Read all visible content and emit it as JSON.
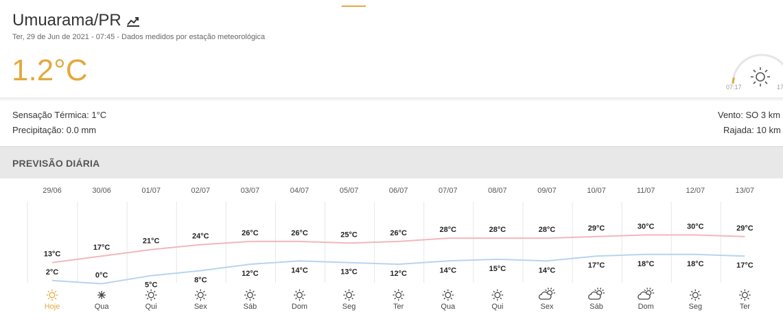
{
  "header": {
    "city": "Umuarama/PR",
    "subtitle": "Ter, 29 de Jun de 2021 - 07:45 - Dados medidos por estação meteorológica",
    "temperature": "1.2°C",
    "sunrise": "07:17",
    "sunset_partial": "17"
  },
  "details": {
    "feels_like": "Sensação Térmica: 1°C",
    "precipitation": "Precipitação: 0.0 mm",
    "wind": "Vento: SO 3 km",
    "gust": "Rajada: 10 km"
  },
  "section": {
    "title": "PREVISÃO DIÁRIA"
  },
  "colors": {
    "accent": "#e3a93c",
    "max_line": "#f2b6bc",
    "min_line": "#b6d4ef"
  },
  "chart_data": {
    "type": "line",
    "categories": [
      "29/06",
      "30/06",
      "01/07",
      "02/07",
      "03/07",
      "04/07",
      "05/07",
      "06/07",
      "07/07",
      "08/07",
      "09/07",
      "10/07",
      "11/07",
      "12/07",
      "13/07"
    ],
    "series": [
      {
        "values": [
          13,
          17,
          21,
          24,
          26,
          26,
          25,
          26,
          28,
          28,
          28,
          29,
          30,
          30,
          29
        ],
        "color": "#f2b6bc"
      },
      {
        "values": [
          2,
          0,
          5,
          8,
          12,
          14,
          13,
          12,
          14,
          15,
          14,
          17,
          18,
          18,
          17
        ],
        "color": "#b6d4ef"
      }
    ],
    "unit": "°C",
    "days": [
      "Hoje",
      "Qua",
      "Qui",
      "Sex",
      "Sáb",
      "Dom",
      "Seg",
      "Ter",
      "Qua",
      "Qui",
      "Sex",
      "Sáb",
      "Dom",
      "Seg",
      "Ter"
    ],
    "icons": [
      "sun-icon",
      "moon-star-icon",
      "sun-icon",
      "sun-icon",
      "sun-icon",
      "sun-icon",
      "sun-icon",
      "sun-icon",
      "sun-icon",
      "sun-icon",
      "cloud-sun-icon",
      "cloud-sun-icon",
      "cloud-sun-icon",
      "sun-icon",
      "sun-icon"
    ]
  }
}
